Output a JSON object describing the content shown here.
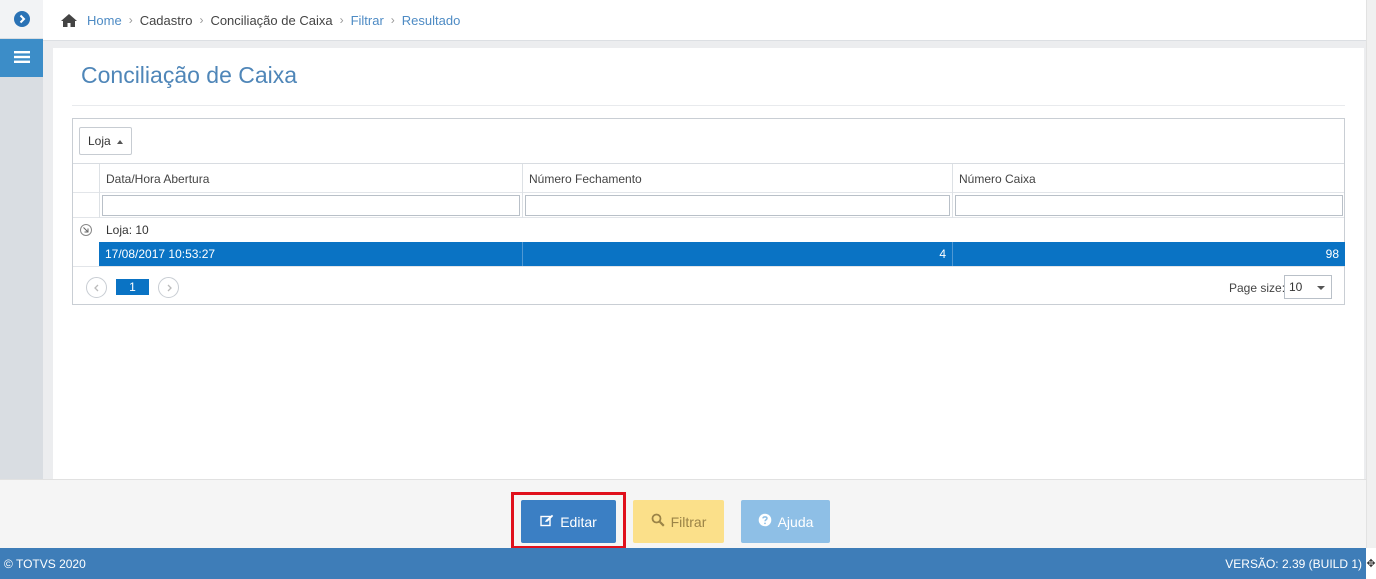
{
  "breadcrumb": {
    "items": [
      {
        "label": "Home"
      },
      {
        "label": "Cadastro"
      },
      {
        "label": "Conciliação de Caixa"
      },
      {
        "label": "Filtrar"
      },
      {
        "label": "Resultado"
      }
    ]
  },
  "page": {
    "title": "Conciliação de Caixa"
  },
  "grid": {
    "group_chip": "Loja",
    "columns": [
      "Data/Hora Abertura",
      "Número Fechamento",
      "Número Caixa"
    ],
    "group_label": "Loja: 10",
    "rows": [
      {
        "data_hora_abertura": "17/08/2017 10:53:27",
        "numero_fechamento": "4",
        "numero_caixa": "98"
      }
    ],
    "pager": {
      "current_page": "1",
      "page_size_label": "Page size:",
      "page_size_value": "10"
    }
  },
  "actions": {
    "edit_label": "Editar",
    "filter_label": "Filtrar",
    "help_label": "Ajuda"
  },
  "footer": {
    "copyright": "© TOTVS 2020",
    "version": "VERSÃO: 2.39 (BUILD 1)"
  },
  "colors": {
    "accent": "#3b7fc4",
    "selected_row": "#0a73c4",
    "highlight_border": "#e0101c",
    "footer": "#3e7db8"
  }
}
